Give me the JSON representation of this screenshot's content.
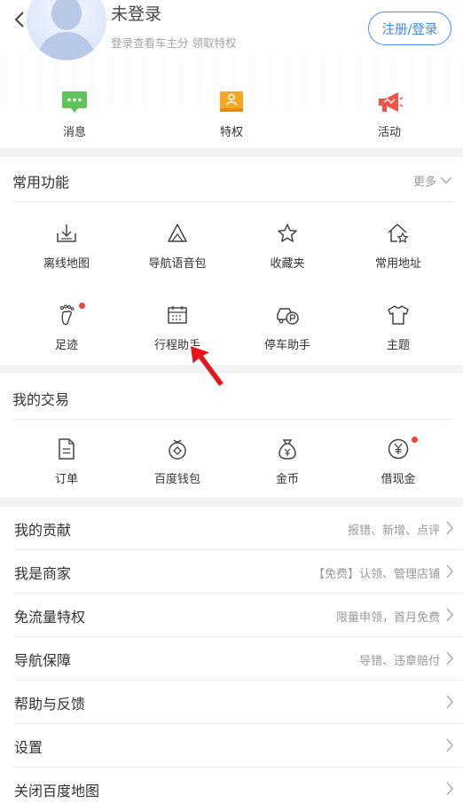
{
  "header": {
    "username": "未登录",
    "subtitle": "登录查看车主分 领取特权",
    "login_button": "注册/登录"
  },
  "quick_actions": [
    {
      "label": "消息",
      "icon": "message-icon",
      "color": "#5fc35b"
    },
    {
      "label": "特权",
      "icon": "privilege-icon",
      "color": "#f5a623"
    },
    {
      "label": "活动",
      "icon": "megaphone-icon",
      "color": "#f0534a"
    }
  ],
  "common": {
    "title": "常用功能",
    "more": "更多",
    "items": [
      {
        "label": "离线地图",
        "icon": "offline-map-icon"
      },
      {
        "label": "导航语音包",
        "icon": "voice-pack-icon"
      },
      {
        "label": "收藏夹",
        "icon": "star-icon"
      },
      {
        "label": "常用地址",
        "icon": "home-star-icon"
      },
      {
        "label": "足迹",
        "icon": "footprint-icon"
      },
      {
        "label": "行程助手",
        "icon": "calendar-icon"
      },
      {
        "label": "停车助手",
        "icon": "parking-car-icon"
      },
      {
        "label": "主题",
        "icon": "shirt-icon"
      }
    ]
  },
  "trade": {
    "title": "我的交易",
    "items": [
      {
        "label": "订单",
        "icon": "order-icon"
      },
      {
        "label": "百度钱包",
        "icon": "wallet-icon"
      },
      {
        "label": "金币",
        "icon": "coin-bag-icon"
      },
      {
        "label": "借现金",
        "icon": "yuan-circle-icon"
      }
    ]
  },
  "list": [
    {
      "label": "我的贡献",
      "right": "报错、新增、点评"
    },
    {
      "label": "我是商家",
      "right": "【免费】认领、管理店铺"
    },
    {
      "label": "免流量特权",
      "right": "限量申领，首月免费"
    },
    {
      "label": "导航保障",
      "right": "导错、违章赔付"
    },
    {
      "label": "帮助与反馈",
      "right": ""
    },
    {
      "label": "设置",
      "right": ""
    },
    {
      "label": "关闭百度地图",
      "right": ""
    }
  ],
  "colors": {
    "accent": "#3f86ee",
    "badge": "#f0433e",
    "annotation_arrow": "#e8141b"
  }
}
